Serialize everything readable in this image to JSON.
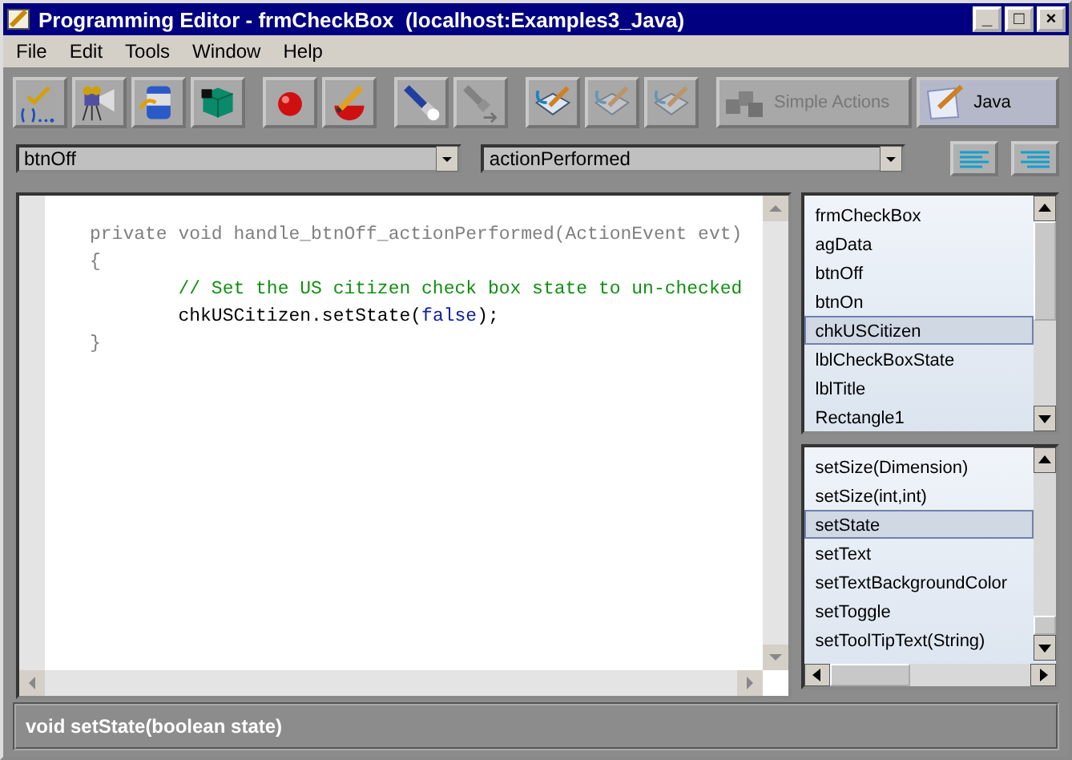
{
  "window": {
    "title": "Programming Editor - frmCheckBox  (localhost:Examples3_Java)",
    "controls": [
      "_",
      "□",
      "×"
    ]
  },
  "menu": [
    "File",
    "Edit",
    "Tools",
    "Window",
    "Help"
  ],
  "toolbar": [
    {
      "kind": "check",
      "disabled": false
    },
    {
      "kind": "camera",
      "disabled": false
    },
    {
      "kind": "jar",
      "disabled": false
    },
    {
      "kind": "cube",
      "disabled": false
    },
    {
      "kind": "ball",
      "disabled": false
    },
    {
      "kind": "ballpen",
      "disabled": false
    },
    {
      "kind": "torch",
      "disabled": false
    },
    {
      "kind": "torcharrow",
      "disabled": true
    },
    {
      "kind": "page",
      "disabled": false
    },
    {
      "kind": "page",
      "disabled": true
    },
    {
      "kind": "page",
      "disabled": true
    },
    {
      "kind": "wide",
      "label": "Simple Actions",
      "disabled": true
    },
    {
      "kind": "wide",
      "label": "Java",
      "disabled": false
    }
  ],
  "selectors": [
    {
      "value": "btnOff"
    },
    {
      "value": "actionPerformed"
    }
  ],
  "view_buttons": [
    {
      "kind": "left"
    },
    {
      "kind": "right"
    }
  ],
  "code": [
    {
      "segments": [
        {
          "kind": "decl",
          "text": "private void handle_btnOff_actionPerformed(ActionEvent evt)"
        }
      ]
    },
    {
      "segments": [
        {
          "kind": "decl",
          "text": "{"
        }
      ]
    },
    {
      "segments": [
        {
          "kind": "comment",
          "text": "        // Set the US citizen check box state to un-checked"
        }
      ]
    },
    {
      "segments": [
        {
          "kind": "plain",
          "text": "        chkUSCitizen.setState("
        },
        {
          "kind": "keyword",
          "text": "false"
        },
        {
          "kind": "plain",
          "text": ");"
        }
      ]
    },
    {
      "segments": [
        {
          "kind": "decl",
          "text": "}"
        }
      ]
    }
  ],
  "objects": [
    {
      "label": "frmCheckBox",
      "selected": false
    },
    {
      "label": "agData",
      "selected": false
    },
    {
      "label": "btnOff",
      "selected": false
    },
    {
      "label": "btnOn",
      "selected": false
    },
    {
      "label": "chkUSCitizen",
      "selected": true
    },
    {
      "label": "lblCheckBoxState",
      "selected": false
    },
    {
      "label": "lblTitle",
      "selected": false
    },
    {
      "label": "Rectangle1",
      "selected": false
    }
  ],
  "methods": [
    {
      "label": "setSize(Dimension)",
      "selected": false
    },
    {
      "label": "setSize(int,int)",
      "selected": false
    },
    {
      "label": "setState",
      "selected": true
    },
    {
      "label": "setText",
      "selected": false
    },
    {
      "label": "setTextBackgroundColor",
      "selected": false
    },
    {
      "label": "setToggle",
      "selected": false
    },
    {
      "label": "setToolTipText(String)",
      "selected": false
    }
  ],
  "status_bar": "void setState(boolean state)"
}
